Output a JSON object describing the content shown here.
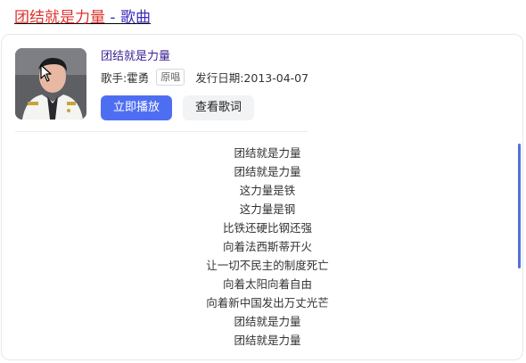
{
  "header": {
    "title_main": "团结就是力量",
    "title_sep": " - ",
    "title_category": "歌曲"
  },
  "song": {
    "name": "团结就是力量",
    "singer_label": "歌手:霍勇",
    "original_badge": "原唱",
    "release_label": "发行日期:2013-04-07"
  },
  "buttons": {
    "play": "立即播放",
    "lyrics": "查看歌词"
  },
  "lyrics": [
    "团结就是力量",
    "团结就是力量",
    "这力量是铁",
    "这力量是钢",
    "比铁还硬比钢还强",
    "向着法西斯蒂开火",
    "让一切不民主的制度死亡",
    "向着太阳向着自由",
    "向着新中国发出万丈光芒",
    "团结就是力量",
    "团结就是力量"
  ],
  "colors": {
    "title_red": "#e0322d",
    "title_blue": "#3a2bbf",
    "accent": "#4e6ef2"
  },
  "icons": {
    "cursor": "arrow-cursor-icon"
  }
}
